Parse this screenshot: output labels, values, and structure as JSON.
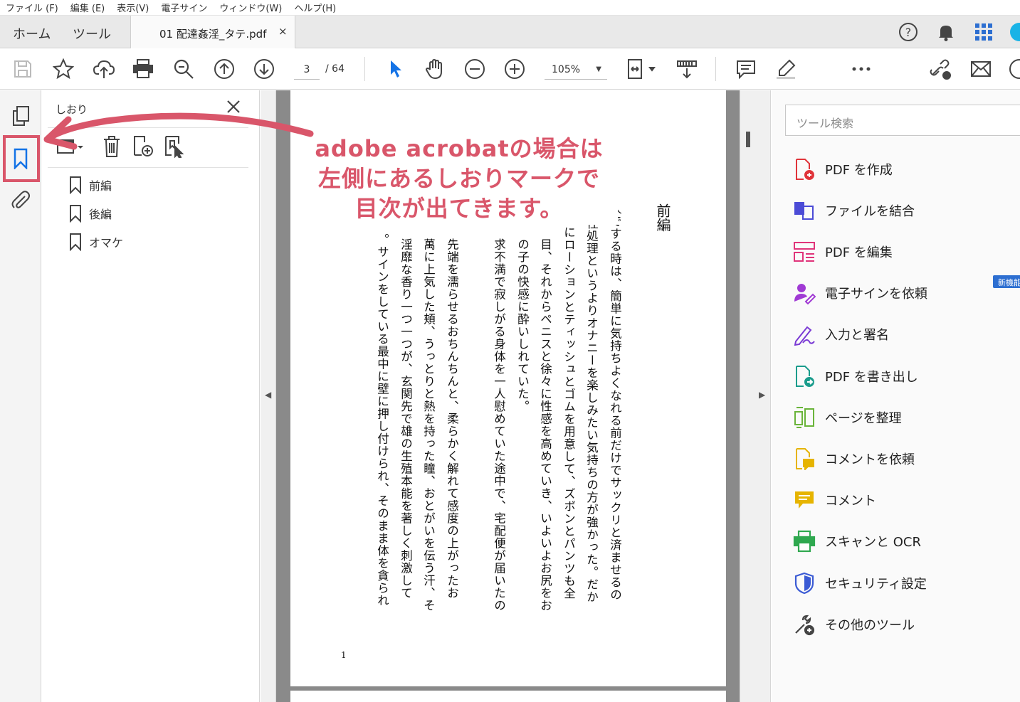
{
  "menu": [
    "ファイル (F)",
    "編集 (E)",
    "表示(V)",
    "電子サイン",
    "ウィンドウ(W)",
    "ヘルプ(H)"
  ],
  "tabs": {
    "home": "ホーム",
    "tools": "ツール",
    "doc": "01 配達姦淫_タテ.pdf",
    "close": "×"
  },
  "toolbar": {
    "page_current": "3",
    "page_total": "/ 64",
    "zoom": "105%",
    "zoom_caret": "▼"
  },
  "bookmarks": {
    "title": "しおり",
    "items": [
      "前編",
      "後編",
      "オマケ"
    ]
  },
  "annotation": {
    "line1": "adobe acrobatの場合は",
    "line2": "左側にあるしおりマークで",
    "line3": "目次が出てきます。"
  },
  "document": {
    "chapter": "前編",
    "page_number": "1",
    "top_fragment": "い",
    "columns": [
      "人でする時は、簡単に気持ちよくなれる前だけでサックリと済ませるの",
      "は性処理というよりオナニーを楽しみたい気持ちの方が強かった。だか",
      "にローションとティッシュとゴムを用意して、ズボンとパンツも全",
      "目、それからペニスと徐々に性感を高めていき、いよいよお尻をお",
      "の子の快感に酔いしれていた。",
      "求不満で寂しがる身体を一人慰めていた途中で、宅配便が届いたの",
      "先端を濡らせるおちんちんと、柔らかく解れて感度の上がったお",
      "萬に上気した頬、うっとりと熱を持った瞳、おとがいを伝う汗、そ",
      "淫靡な香り一つ一つが、玄関先で雄の生殖本能を著しく刺激して",
      "。サインをしている最中に壁に押し付けられ、そのまま体を貪られ"
    ]
  },
  "tools_panel": {
    "search_placeholder": "ツール検索",
    "new_badge": "新機能",
    "items": [
      {
        "label": "PDF を作成",
        "icon": "create-pdf-icon",
        "color": "#e0343a"
      },
      {
        "label": "ファイルを結合",
        "icon": "combine-files-icon",
        "color": "#4b4bd6"
      },
      {
        "label": "PDF を編集",
        "icon": "edit-pdf-icon",
        "color": "#e0347a"
      },
      {
        "label": "電子サインを依頼",
        "icon": "request-signature-icon",
        "color": "#a03ad4"
      },
      {
        "label": "入力と署名",
        "icon": "fill-sign-icon",
        "color": "#7a3ad4"
      },
      {
        "label": "PDF を書き出し",
        "icon": "export-pdf-icon",
        "color": "#1a9c8c"
      },
      {
        "label": "ページを整理",
        "icon": "organize-pages-icon",
        "color": "#6ab43a"
      },
      {
        "label": "コメントを依頼",
        "icon": "request-comments-icon",
        "color": "#e6b400"
      },
      {
        "label": "コメント",
        "icon": "comment-icon",
        "color": "#e6b400"
      },
      {
        "label": "スキャンと OCR",
        "icon": "scan-ocr-icon",
        "color": "#2fa84f"
      },
      {
        "label": "セキュリティ設定",
        "icon": "protect-icon",
        "color": "#3a5ad4"
      },
      {
        "label": "その他のツール",
        "icon": "more-tools-icon",
        "color": "#444444"
      }
    ]
  },
  "colors": {
    "accent": "#1473e6",
    "annotation": "#d9566a"
  }
}
